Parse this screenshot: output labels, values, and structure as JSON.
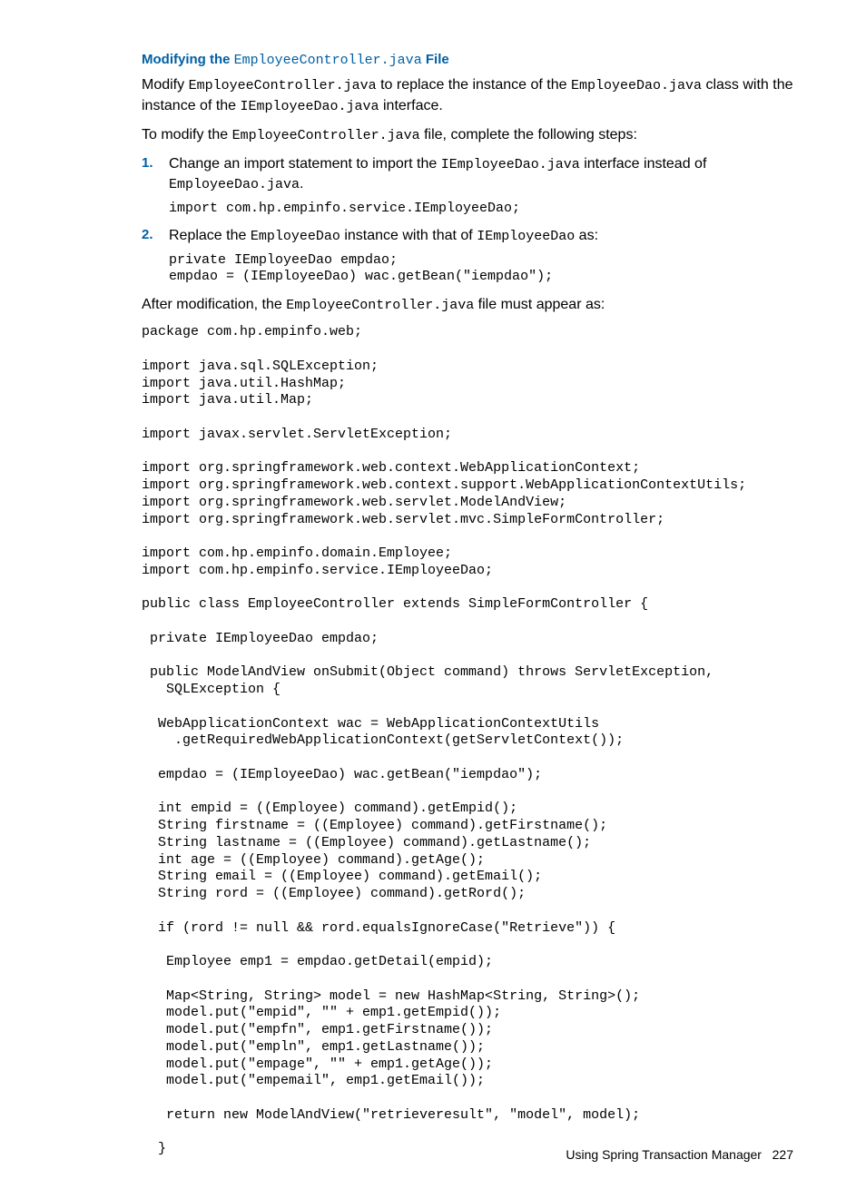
{
  "heading": {
    "prefix": "Modifying the ",
    "filename": "EmployeeController.java",
    "suffix": " File"
  },
  "para1": {
    "t1": "Modify ",
    "c1": "EmployeeController.java",
    "t2": " to replace the instance of the ",
    "c2": "EmployeeDao.java",
    "t3": " class with the instance of the ",
    "c3": "IEmployeeDao.java",
    "t4": " interface."
  },
  "para2": {
    "t1": "To modify the ",
    "c1": "EmployeeController.java",
    "t2": " file, complete the following steps:"
  },
  "step1": {
    "t1": "Change an import statement to import the ",
    "c1": "IEmployeeDao.java",
    "t2": " interface instead of ",
    "c2": "EmployeeDao.java",
    "t3": ".",
    "code": "import com.hp.empinfo.service.IEmployeeDao;"
  },
  "step2": {
    "t1": "Replace the ",
    "c1": "EmployeeDao",
    "t2": " instance with that of ",
    "c2": "IEmployeeDao",
    "t3": " as:",
    "code": "private IEmployeeDao empdao;\nempdao = (IEmployeeDao) wac.getBean(\"iempdao\");"
  },
  "para3": {
    "t1": "After modification, the ",
    "c1": "EmployeeController.java",
    "t2": " file must appear as:"
  },
  "bigcode": "package com.hp.empinfo.web;\n\nimport java.sql.SQLException;\nimport java.util.HashMap;\nimport java.util.Map;\n\nimport javax.servlet.ServletException;\n\nimport org.springframework.web.context.WebApplicationContext;\nimport org.springframework.web.context.support.WebApplicationContextUtils;\nimport org.springframework.web.servlet.ModelAndView;\nimport org.springframework.web.servlet.mvc.SimpleFormController;\n\nimport com.hp.empinfo.domain.Employee;\nimport com.hp.empinfo.service.IEmployeeDao;\n\npublic class EmployeeController extends SimpleFormController {\n\n private IEmployeeDao empdao;\n\n public ModelAndView onSubmit(Object command) throws ServletException,\n   SQLException {\n\n  WebApplicationContext wac = WebApplicationContextUtils\n    .getRequiredWebApplicationContext(getServletContext());\n\n  empdao = (IEmployeeDao) wac.getBean(\"iempdao\");\n\n  int empid = ((Employee) command).getEmpid();\n  String firstname = ((Employee) command).getFirstname();\n  String lastname = ((Employee) command).getLastname();\n  int age = ((Employee) command).getAge();\n  String email = ((Employee) command).getEmail();\n  String rord = ((Employee) command).getRord();\n\n  if (rord != null && rord.equalsIgnoreCase(\"Retrieve\")) {\n\n   Employee emp1 = empdao.getDetail(empid);\n\n   Map<String, String> model = new HashMap<String, String>();\n   model.put(\"empid\", \"\" + emp1.getEmpid());\n   model.put(\"empfn\", emp1.getFirstname());\n   model.put(\"empln\", emp1.getLastname());\n   model.put(\"empage\", \"\" + emp1.getAge());\n   model.put(\"empemail\", emp1.getEmail());\n\n   return new ModelAndView(\"retrieveresult\", \"model\", model);\n\n  }",
  "footer": {
    "text": "Using Spring Transaction Manager",
    "page": "227"
  }
}
